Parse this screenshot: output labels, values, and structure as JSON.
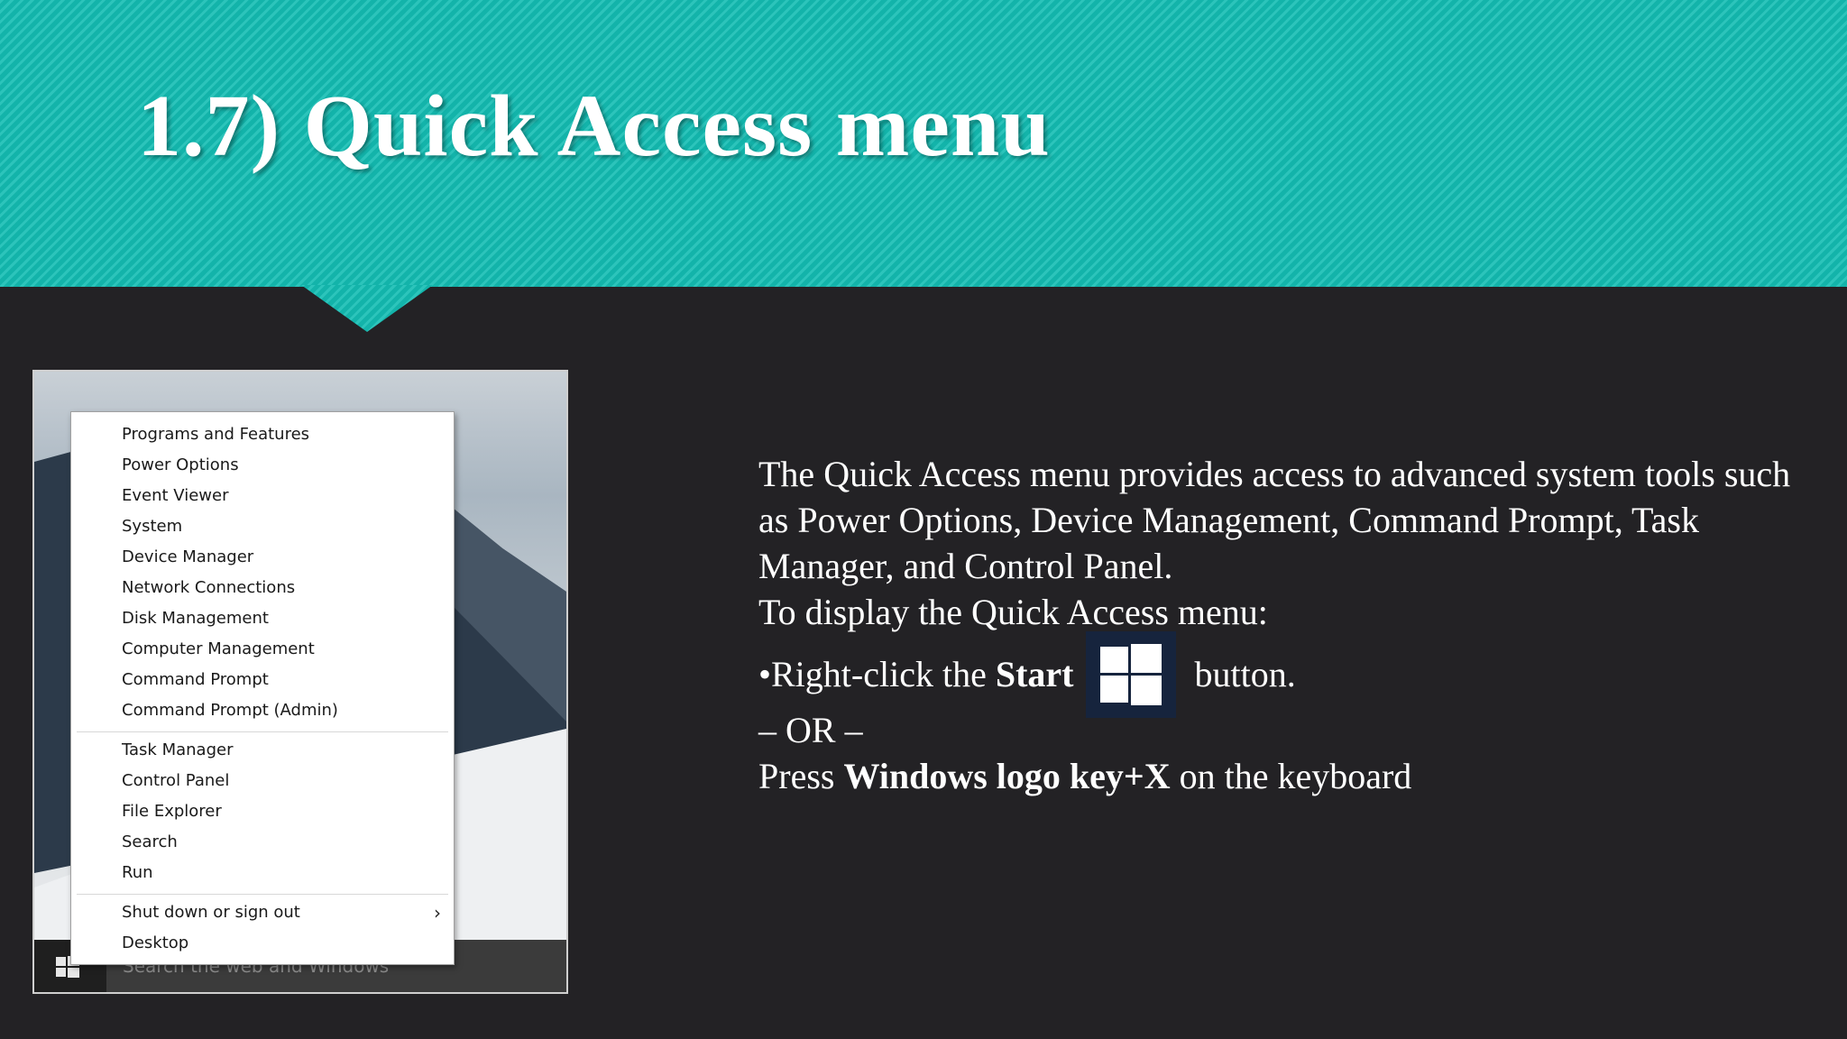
{
  "slide": {
    "title": "1.7) Quick Access menu"
  },
  "colors": {
    "banner": "#14bdb3",
    "background": "#232225",
    "start_icon_bg": "#16243d"
  },
  "context_menu": {
    "group1": [
      "Programs and Features",
      "Power Options",
      "Event Viewer",
      "System",
      "Device Manager",
      "Network Connections",
      "Disk Management",
      "Computer Management",
      "Command Prompt",
      "Command Prompt (Admin)"
    ],
    "group2": [
      "Task Manager",
      "Control Panel",
      "File Explorer",
      "Search",
      "Run"
    ],
    "group3": [
      "Shut down or sign out",
      "Desktop"
    ],
    "submenu_arrow": "›"
  },
  "taskbar": {
    "search_placeholder": "Search the web and Windows",
    "start_icon": "windows-logo-icon"
  },
  "body": {
    "intro": "The Quick Access menu provides access to advanced system tools such as Power Options, Device Management, Command Prompt, Task Manager, and Control Panel.",
    "display_heading": "To display the Quick Access menu:",
    "step1_prefix": "•Right-click the ",
    "step1_bold": "Start",
    "step1_suffix": " button.",
    "or": "– OR –",
    "step2_prefix": "Press ",
    "step2_bold": "Windows logo key+X",
    "step2_suffix": " on the keyboard"
  }
}
